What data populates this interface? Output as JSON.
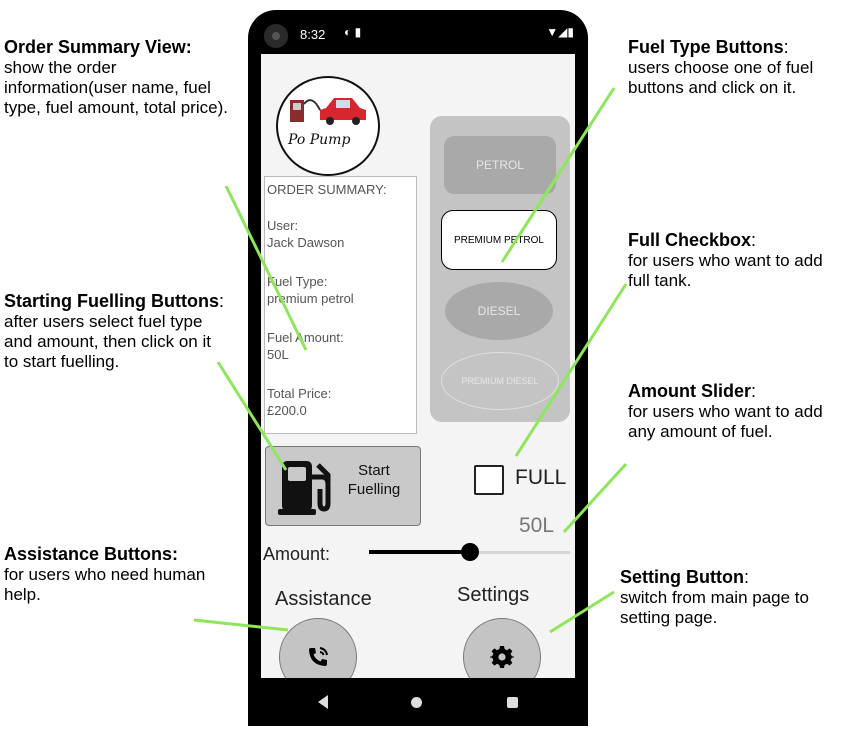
{
  "annotations": {
    "order_summary": {
      "title": "Order Summary View:",
      "body": "show the order information(user name, fuel type, fuel amount, total price)."
    },
    "starting_fuelling": {
      "title": "Starting Fuelling Buttons",
      "body": "after users select fuel type and amount, then click on it to start fuelling."
    },
    "assistance": {
      "title": "Assistance Buttons:",
      "body": "for users who need human help."
    },
    "fuel_type": {
      "title": "Fuel Type Buttons",
      "body": "users choose one of fuel buttons and click on it."
    },
    "full_checkbox": {
      "title": "Full Checkbox",
      "body": "for users who want to add full tank."
    },
    "amount_slider": {
      "title": "Amount Slider",
      "body": "for users who want to add any amount of fuel."
    },
    "setting_button": {
      "title": "Setting Button",
      "body": "switch from main page to setting page."
    }
  },
  "status_bar": {
    "time": "8:32"
  },
  "app": {
    "logo_text": "Po Pump",
    "summary": {
      "heading": "ORDER SUMMARY:",
      "user_label": "User:",
      "user_value": "Jack Dawson",
      "fuel_type_label": "Fuel Type:",
      "fuel_type_value": "premium petrol",
      "fuel_amount_label": "Fuel Amount:",
      "fuel_amount_value": "50L",
      "total_price_label": "Total Price:",
      "total_price_value": "£200.0"
    },
    "fuel_buttons": {
      "petrol": "PETROL",
      "premium_petrol": "PREMIUM PETROL",
      "diesel": "DIESEL",
      "premium_diesel": "PREMIUM DIESEL",
      "selected": "premium_petrol"
    },
    "start_button": {
      "label_line1": "Start",
      "label_line2": "Fuelling"
    },
    "full_checkbox": {
      "label": "FULL",
      "checked": false
    },
    "amount": {
      "label": "Amount:",
      "value_text": "50L",
      "fraction": 0.5
    },
    "assistance_label": "Assistance",
    "settings_label": "Settings"
  },
  "colors": {
    "accent_arrow": "#8ee65a",
    "panel": "#c4c4c4"
  }
}
